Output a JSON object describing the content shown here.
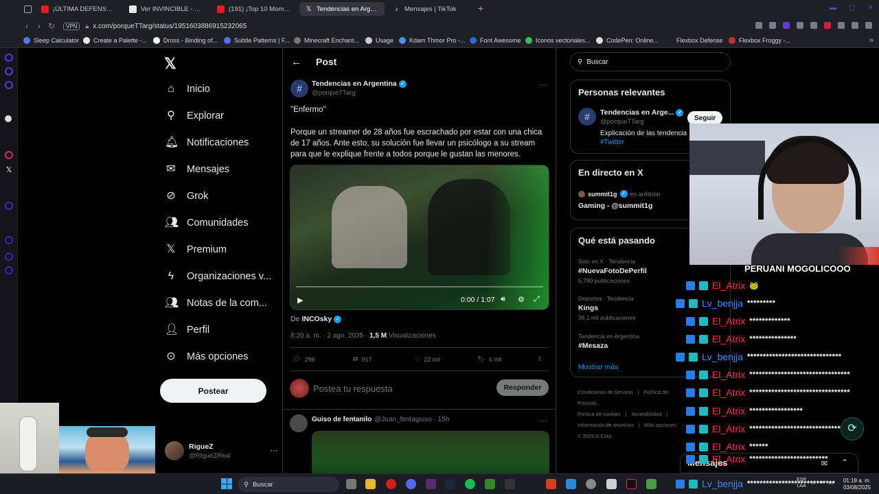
{
  "browser": {
    "tabs": [
      {
        "title": "¡ÚLTIMA DEFENSA de Mi...",
        "fav": "#e02020"
      },
      {
        "title": "Ver INVINCIBLE - Tempo...",
        "fav": "#e8e8e8"
      },
      {
        "title": "(191) ¡Top 10 Momentos d...",
        "fav": "#e02020"
      },
      {
        "title": "Tendencias en Argentina",
        "fav": "#000000",
        "active": true
      },
      {
        "title": "Mensajes | TikTok",
        "fav": "#111111"
      }
    ],
    "new_tab": "+",
    "vpn": "VPN",
    "url": "x.com/porqueTTarg/status/1951603886915232065",
    "bookmarks": [
      {
        "label": "Sleep Calculator",
        "color": "#4a7dff"
      },
      {
        "label": "Create a Palette -...",
        "color": "#e8e8e8"
      },
      {
        "label": "Dross - Binding of...",
        "color": "#ffffff"
      },
      {
        "label": "Subtle Patterns | F...",
        "color": "#5a6aff"
      },
      {
        "label": "Minecraft Enchant...",
        "color": "#777777"
      },
      {
        "label": "Usage",
        "color": "#cccccc"
      },
      {
        "label": "Kdam Thmor Pro -...",
        "color": "#4a90ff"
      },
      {
        "label": "Font Awesome",
        "color": "#2a6ad0"
      },
      {
        "label": "Iconos vectoriales...",
        "color": "#38c060"
      },
      {
        "label": "CodePen: Online...",
        "color": "#dddddd"
      },
      {
        "label": "Flexbox Defense",
        "color": "#1f1f26"
      },
      {
        "label": "Flexbox Froggy -...",
        "color": "#c03030"
      }
    ]
  },
  "x": {
    "nav": [
      {
        "label": "Inicio",
        "icon": "home-icon",
        "glyph": "⌂"
      },
      {
        "label": "Explorar",
        "icon": "search-icon",
        "glyph": "⚲"
      },
      {
        "label": "Notificaciones",
        "icon": "bell-icon",
        "glyph": "🔔︎"
      },
      {
        "label": "Mensajes",
        "icon": "mail-icon",
        "glyph": "✉"
      },
      {
        "label": "Grok",
        "icon": "grok-icon",
        "glyph": "⊘"
      },
      {
        "label": "Comunidades",
        "icon": "communities-icon",
        "glyph": "👥︎"
      },
      {
        "label": "Premium",
        "icon": "x-premium-icon",
        "glyph": "𝕏"
      },
      {
        "label": "Organizaciones v...",
        "icon": "lightning-icon",
        "glyph": "ϟ"
      },
      {
        "label": "Notas de la com...",
        "icon": "community-notes-icon",
        "glyph": "👥︎"
      },
      {
        "label": "Perfil",
        "icon": "profile-icon",
        "glyph": "👤︎"
      },
      {
        "label": "Más opciones",
        "icon": "more-circle-icon",
        "glyph": "⊙"
      }
    ],
    "post_button": "Postear",
    "profile": {
      "name": "RigueZ",
      "handle": "@RIgueZReal"
    },
    "header": "Post",
    "post": {
      "author": "Tendencias en Argentina",
      "handle": "@porqueTTarg",
      "quote": "\"Enfermo\"",
      "body": "Porque un streamer de 28 años fue escrachado por estar con una chica de 17 años. Ante esto, su solución fue llevar un psicólogo a su stream para que le explique frente a todos porque le gustan las menores.",
      "video_time": "0:00 / 1:07",
      "from_label": "De",
      "from_user": "INCOsky",
      "date": "8:20 a. m. · 2 ago. 2025 ·",
      "views": "1,5 M",
      "views_label": "Visualizaciones",
      "replies": "296",
      "reposts": "917",
      "likes": "22 mil",
      "bookmarks": "4 mil"
    },
    "reply_placeholder": "Postea tu respuesta",
    "reply_button": "Responder",
    "reply2": {
      "name": "Guiso de fentanilo",
      "handle": "@Juan_fentaguiso · 15h"
    },
    "search_placeholder": "Buscar",
    "relevant": {
      "title": "Personas relevantes",
      "name": "Tendencias en Arge...",
      "handle": "@porqueTTarg",
      "bio": "Explicación de las tendencia",
      "bio_tag": "#Twitter",
      "follow": "Seguir"
    },
    "live": {
      "title": "En directo en X",
      "host": "summit1g",
      "role": "es anfitrión",
      "name": "Gaming - @summit1g"
    },
    "trends": {
      "title": "Qué está pasando",
      "items": [
        {
          "context": "Solo en X · Tendencia",
          "name": "#NuevaFotoDePerfil",
          "count": "5,780 publicaciones"
        },
        {
          "context": "Deportes · Tendencia",
          "name": "Kings",
          "count": "36,1 mil publicaciones"
        },
        {
          "context": "Tendencia en Argentina",
          "name": "#Mesaza",
          "count": ""
        }
      ],
      "show_more": "Mostrar más"
    },
    "footer": [
      "Condiciones de Servicio",
      "|",
      "Política de Privacid...",
      "Política de cookies",
      "|",
      "Accesibilidad",
      "|",
      "Información de anuncios",
      "|",
      "Más opciones",
      "···",
      "© 2025 X Corp."
    ],
    "messages_dock": "Mensajes"
  },
  "chat": {
    "title": "PERUANI MOGOLICOOO",
    "lines": [
      {
        "user": "El_Atrix",
        "msg": "🐸",
        "kind": "atrix"
      },
      {
        "user": "Lv_benjja",
        "msg": "*********",
        "kind": "benja"
      },
      {
        "user": "El_Atrix",
        "msg": "*************",
        "kind": "atrix"
      },
      {
        "user": "El_Atrix",
        "msg": "***************",
        "kind": "atrix"
      },
      {
        "user": "Lv_benjja",
        "msg": "******************************",
        "kind": "benja"
      },
      {
        "user": "El_Atrix",
        "msg": "********************************",
        "kind": "atrix"
      },
      {
        "user": "El_Atrix",
        "msg": "********************************",
        "kind": "atrix"
      },
      {
        "user": "El_Atrix",
        "msg": "*****************",
        "kind": "atrix"
      },
      {
        "user": "El_Atrix",
        "msg": "******************************",
        "kind": "atrix"
      },
      {
        "user": "El_Atrix",
        "msg": "******",
        "kind": "atrix"
      },
      {
        "user": "El_Atrix",
        "msg": "*************************",
        "kind": "atrix"
      },
      {
        "user": "Lv_benjja",
        "msg": "****************************",
        "kind": "benja"
      }
    ]
  },
  "taskbar": {
    "search": "Buscar",
    "lang_1": "ESP",
    "lang_2": "LAA",
    "time": "01:19 a. m.",
    "date": "03/08/2025"
  },
  "colors": {
    "accent": "#1d9bf0",
    "background": "#000000",
    "atrix": "#ff3355",
    "benja": "#3d8cff"
  }
}
